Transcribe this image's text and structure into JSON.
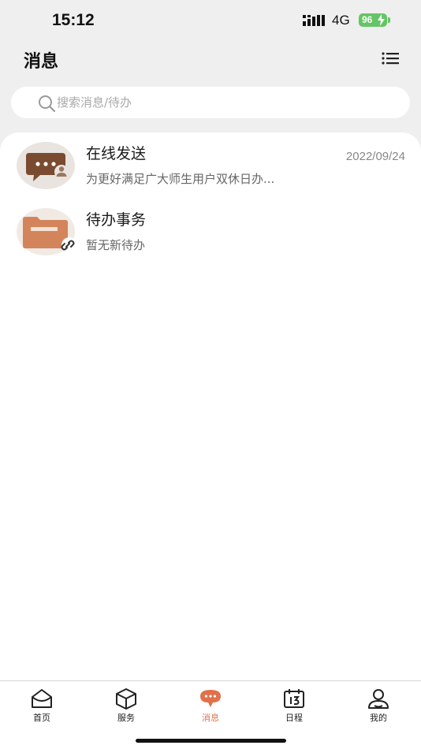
{
  "status_bar": {
    "time": "15:12",
    "network": "4G",
    "battery": "96"
  },
  "header": {
    "title": "消息",
    "menu_icon": "list-icon"
  },
  "search": {
    "placeholder": "搜索消息/待办",
    "value": ""
  },
  "messages": [
    {
      "title": "在线发送",
      "date": "2022/09/24",
      "preview": "为更好满足广大师生用户双休日办...",
      "icon": "chat-bubble-icon"
    },
    {
      "title": "待办事务",
      "date": "",
      "preview": "暂无新待办",
      "icon": "folder-icon"
    }
  ],
  "tabs": [
    {
      "label": "首页",
      "icon": "home-icon",
      "active": false
    },
    {
      "label": "服务",
      "icon": "cube-icon",
      "active": false
    },
    {
      "label": "消息",
      "icon": "message-icon",
      "active": true
    },
    {
      "label": "日程",
      "icon": "calendar-icon",
      "active": false
    },
    {
      "label": "我的",
      "icon": "user-icon",
      "active": false
    }
  ],
  "colors": {
    "accent": "#e0714b",
    "battery": "#65c466",
    "chat_icon": "#7a4b30",
    "folder_icon": "#d4845a"
  }
}
